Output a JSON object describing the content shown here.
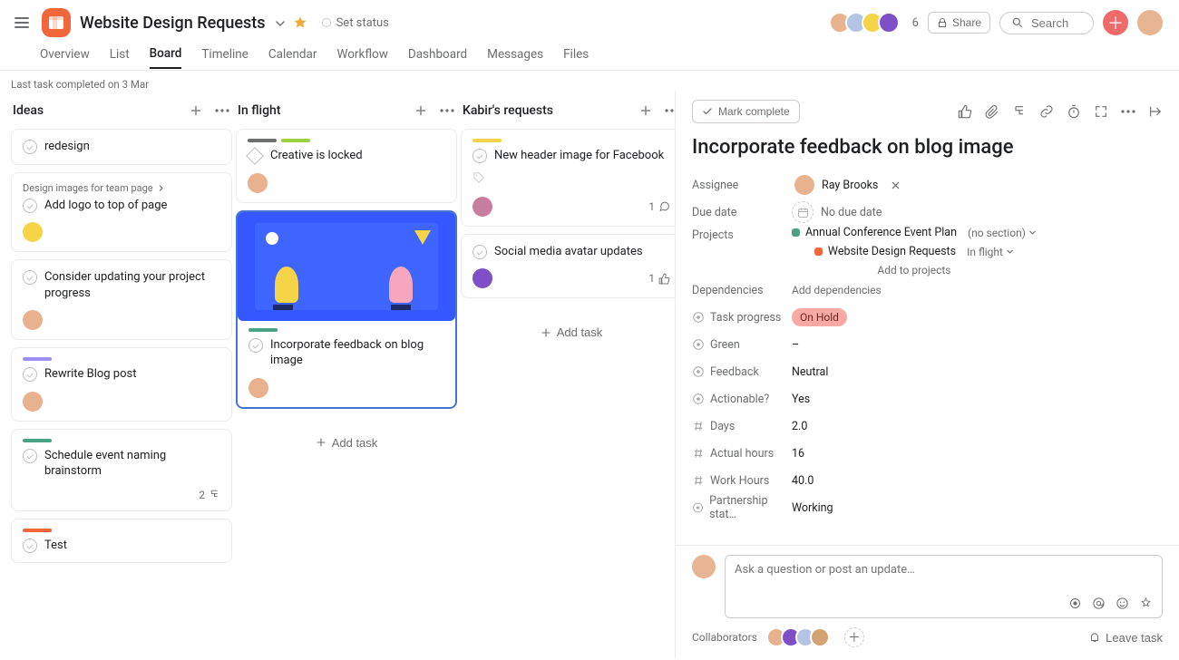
{
  "header": {
    "project_title": "Website Design Requests",
    "set_status_label": "Set status",
    "member_count": "6",
    "share_label": "Share",
    "search_placeholder": "Search"
  },
  "tabs": {
    "items": [
      "Overview",
      "List",
      "Board",
      "Timeline",
      "Calendar",
      "Workflow",
      "Dashboard",
      "Messages",
      "Files"
    ],
    "active_index": 2
  },
  "status_line": "Last task completed on 3 Mar",
  "columns": [
    {
      "title": "Ideas",
      "cards": [
        {
          "title": "redesign",
          "shape": "circle"
        },
        {
          "parent": "Design images for team page",
          "title": "Add logo to top of page",
          "shape": "circle",
          "avatar": "a3"
        },
        {
          "title": "Consider updating your project progress",
          "shape": "circle",
          "avatar": "a1"
        },
        {
          "pills": [
            "#9b8ff4"
          ],
          "title": "Rewrite Blog post",
          "shape": "circle",
          "avatar": "a1",
          "tag_dot": true
        },
        {
          "pills": [
            "#4aa284"
          ],
          "title": "Schedule event naming brainstorm",
          "shape": "circle",
          "meta_count": "2",
          "meta_icon": "subtasks"
        },
        {
          "pills": [
            "#f1673b"
          ],
          "title": "Test",
          "shape": "circle"
        }
      ]
    },
    {
      "title": "In flight",
      "show_add_task": true,
      "cards": [
        {
          "pills": [
            "#6d6e6f",
            "#9bd041"
          ],
          "title": "Creative is locked",
          "shape": "diamond",
          "avatar": "a1"
        },
        {
          "cover": true,
          "pills": [
            "#4aa284"
          ],
          "title": "Incorporate feedback on blog image",
          "shape": "circle",
          "avatar": "a1",
          "selected": true
        }
      ]
    },
    {
      "title": "Kabir's requests",
      "show_add_task": true,
      "cards": [
        {
          "pills": [
            "#f5d547"
          ],
          "title": "New header image for Facebook",
          "shape": "circle",
          "avatar": "a6",
          "show_tag_icon": true,
          "meta_count": "1",
          "meta_icon": "comment"
        },
        {
          "title": "Social media avatar updates",
          "shape": "circle",
          "avatar": "a4",
          "meta_count": "1",
          "meta_icon": "thumb"
        }
      ]
    }
  ],
  "add_task_label": "Add task",
  "detail": {
    "mark_complete": "Mark complete",
    "title": "Incorporate feedback on blog image",
    "assignee_label": "Assignee",
    "assignee_name": "Ray Brooks",
    "due_label": "Due date",
    "due_value": "No due date",
    "projects_label": "Projects",
    "projects": [
      {
        "color": "#4aa284",
        "name": "Annual Conference Event Plan",
        "section": "(no section)"
      },
      {
        "color": "#f1673b",
        "name": "Website Design Requests",
        "section": "In flight"
      }
    ],
    "add_to_projects": "Add to projects",
    "dependencies_label": "Dependencies",
    "add_dependencies": "Add dependencies",
    "fields": [
      {
        "icon": "status",
        "label": "Task progress",
        "value_pill": "On Hold"
      },
      {
        "icon": "status",
        "label": "Green",
        "value": "–"
      },
      {
        "icon": "status",
        "label": "Feedback",
        "value": "Neutral"
      },
      {
        "icon": "status",
        "label": "Actionable?",
        "value": "Yes"
      },
      {
        "icon": "number",
        "label": "Days",
        "value": "2.0"
      },
      {
        "icon": "number",
        "label": "Actual hours",
        "value": "16"
      },
      {
        "icon": "number",
        "label": "Work Hours",
        "value": "40.0"
      },
      {
        "icon": "status",
        "label": "Partnership stat…",
        "value": "Working"
      }
    ],
    "comment_placeholder": "Ask a question or post an update…",
    "collab_label": "Collaborators",
    "leave_task": "Leave task"
  }
}
